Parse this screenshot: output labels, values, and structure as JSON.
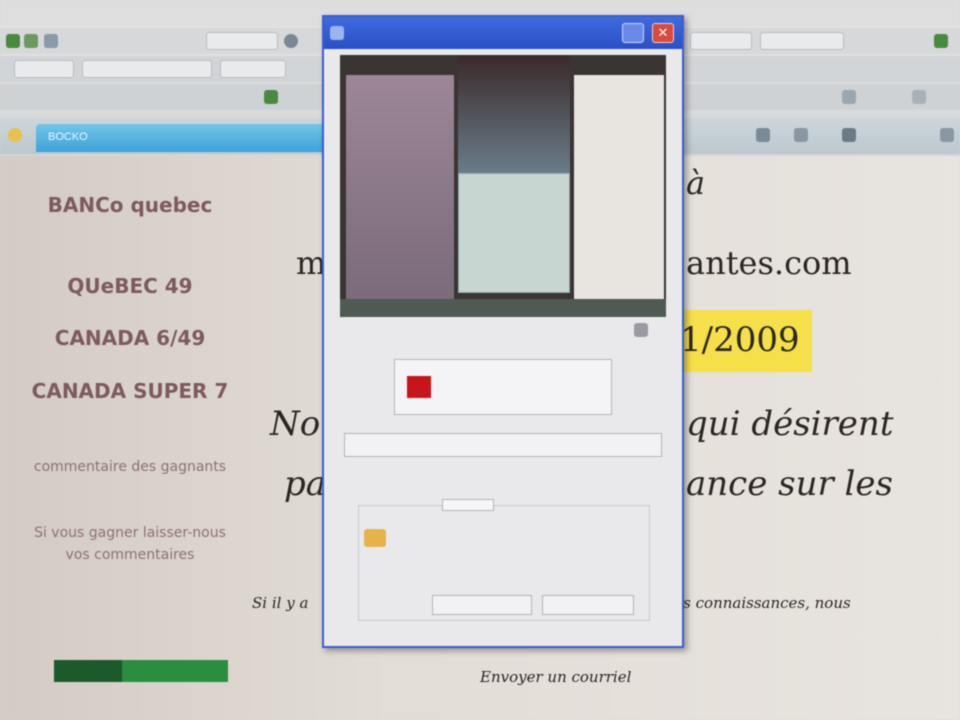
{
  "page": {
    "side_links": [
      "BANCo quebec",
      "QUeBEC 49",
      "CANADA 6/49",
      "CANADA SUPER 7",
      "commentaire des gagnants",
      "Si vous gagner laisser-nous vos commentaires"
    ],
    "headline_line1": "à",
    "headline_line2_left": "m",
    "headline_line2_right": "antes.com",
    "date_fragment": "1/2009",
    "para1_left": "No",
    "para1_right": "qui désirent",
    "para2_left": "pa",
    "para2_right": "ance sur les",
    "small_left": "Si il y a",
    "small_right": "rs connaissances, nous",
    "contact_link": "Envoyer un courriel",
    "highlight_color": "#f6e04a",
    "text_color": "#2c2622",
    "link_color": "#7e5a5c"
  },
  "browser": {
    "tab_label": "BOCKO",
    "title_accent": "#3ea2d8"
  },
  "dialog": {
    "record_button_color": "#c8151c"
  }
}
